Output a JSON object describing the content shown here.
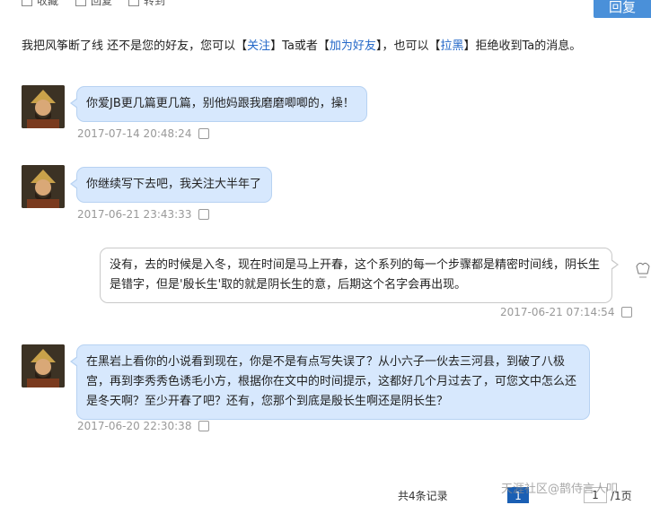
{
  "top": {
    "item1": "收藏",
    "item2": "回复",
    "item3": "转到",
    "reply_button": "回复"
  },
  "notice": {
    "prefix": "我把风筝断了线 还不是您的好友，您可以【",
    "follow": "关注",
    "mid1": "】Ta或者【",
    "add_friend": "加为好友",
    "mid2": "】，也可以【",
    "block": "拉黑",
    "suffix": "】拒绝收到Ta的消息。"
  },
  "messages": [
    {
      "side": "left",
      "text": "你爱JB更几篇更几篇，别他妈跟我磨磨唧唧的，操！",
      "time": "2017-07-14 20:48:24"
    },
    {
      "side": "left",
      "text": "你继续写下去吧，我关注大半年了",
      "time": "2017-06-21 23:43:33"
    },
    {
      "side": "right",
      "text": "没有，去的时候是入冬，现在时间是马上开春，这个系列的每一个步骤都是精密时间线，阴长生是错字，但是'殷长生'取的就是阴长生的意，后期这个名字会再出现。",
      "time": "2017-06-21 07:14:54"
    },
    {
      "side": "left",
      "text": "在黑岩上看你的小说看到现在，你是不是有点写失误了？从小六子一伙去三河县，到破了八极宫，再到李秀秀色诱毛小方，根据你在文中的时间提示，这都好几个月过去了，可您文中怎么还是冬天啊？至少开春了吧？还有，您那个到底是殷长生啊还是阴长生？",
      "time": "2017-06-20 22:30:38"
    }
  ],
  "pager": {
    "total": "共4条记录",
    "current": "1",
    "input": "1",
    "of": "/1页"
  },
  "watermark": "天涯社区@鹊侍言人叩",
  "colors": {
    "bubble_left": "#d7e8fd",
    "bubble_border": "#b7d2f2",
    "accent": "#4a90d9",
    "link": "#2468c8",
    "page_active": "#1a5fb4"
  }
}
